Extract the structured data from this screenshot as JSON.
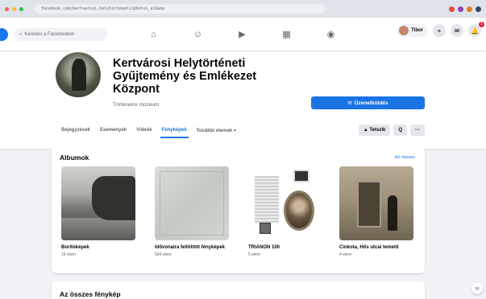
{
  "browser": {
    "url": "facebook.com/kertvarosi.helytorteneti/photos_albums"
  },
  "topnav": {
    "search_placeholder": "Keresés a Facebookon",
    "profile_name": "Tibor",
    "notification_count": "1"
  },
  "page": {
    "title": "Kertvárosi Helytörténeti Gyűjtemény és Emlékezet Központ",
    "category": "Történelmi múzeum",
    "follow_label": "Üzenetküldés",
    "tabs": [
      "Bejegyzések",
      "Események",
      "Videók",
      "Fényképek",
      "További elemek ▾"
    ],
    "active_tab": 3,
    "share_label": "Tetszik",
    "search_icon_label": "Q",
    "more_label": "···"
  },
  "albums": {
    "title": "Albumok",
    "see_all": "Az összes",
    "items": [
      {
        "name": "Borítóképek",
        "count": "16 elem"
      },
      {
        "name": "Idővonalra feltöltött fényképek",
        "count": "594 elem"
      },
      {
        "name": "TRIANON 100",
        "count": "5 elem"
      },
      {
        "name": "Cinkota, Hős utcai temető",
        "count": "4 elem"
      }
    ]
  },
  "all_photos": {
    "title": "Az összes fénykép"
  }
}
